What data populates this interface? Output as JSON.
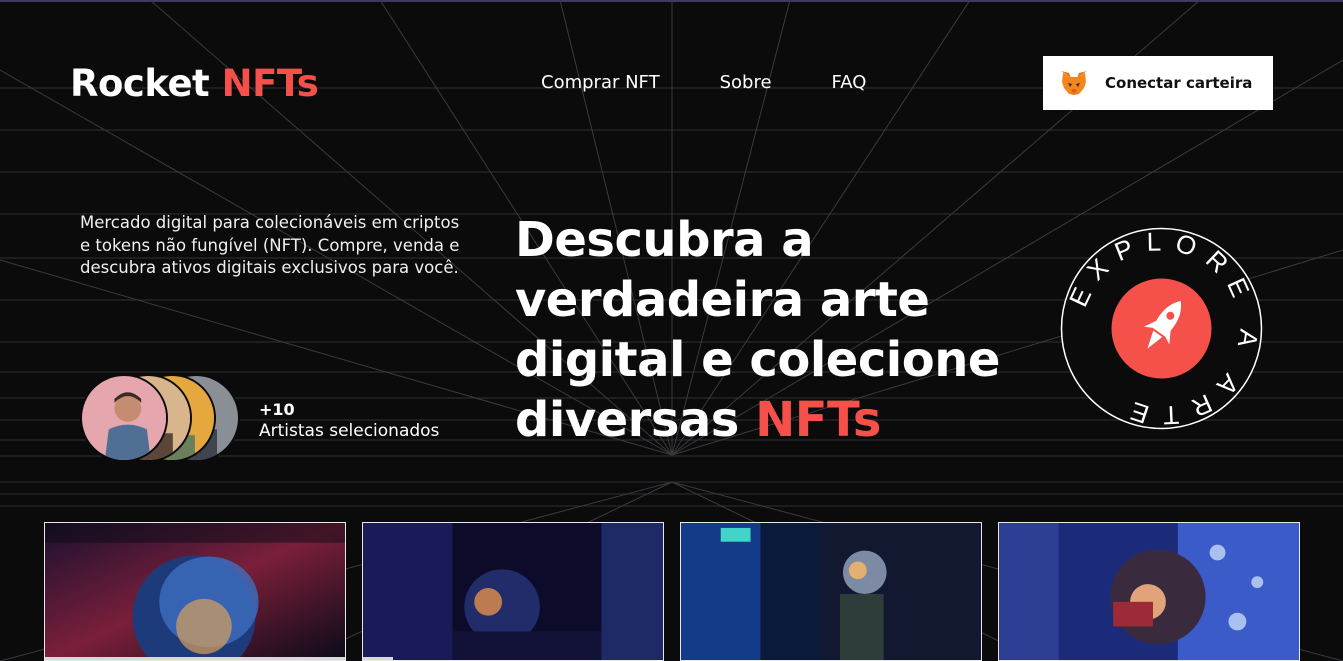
{
  "header": {
    "logo_main": "Rocket",
    "logo_accent": "NFTs",
    "nav": [
      "Comprar NFT",
      "Sobre",
      "FAQ"
    ],
    "wallet_button": "Conectar carteira"
  },
  "hero": {
    "description": "Mercado digital para colecionáveis em criptos e tokens não fungível (NFT). Compre, venda e descubra ativos digitais exclusivos para você.",
    "artists_count": "+10",
    "artists_label": "Artistas selecionados",
    "headline_main": "Descubra a verdadeira arte digital e colecione diversas",
    "headline_accent": "NFTs",
    "badge_text": "EXPLORE A ARTE"
  },
  "colors": {
    "background": "#0b0b0c",
    "accent": "#f6504a",
    "text": "#ffffff",
    "button_bg": "#ffffff"
  },
  "icons": {
    "wallet": "metamask-fox-icon",
    "badge": "rocket-icon"
  },
  "gallery": {
    "items": [
      "astronaut-nft-1",
      "astronaut-nft-2",
      "astronaut-nft-3",
      "astronaut-nft-4"
    ]
  }
}
